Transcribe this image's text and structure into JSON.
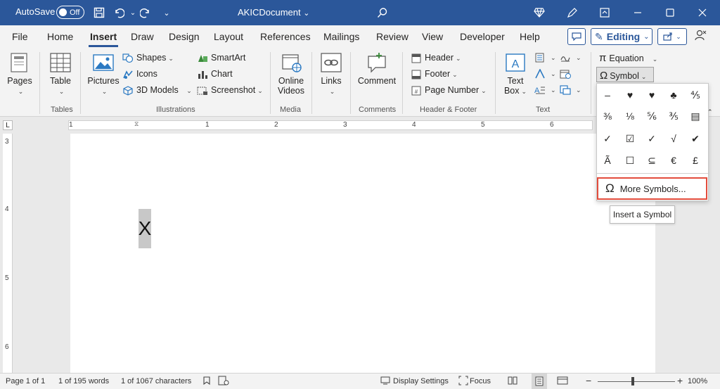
{
  "titlebar": {
    "autosave_label": "AutoSave",
    "autosave_state": "Off",
    "document_title": "AKICDocument"
  },
  "tabs": [
    "File",
    "Home",
    "Insert",
    "Draw",
    "Design",
    "Layout",
    "References",
    "Mailings",
    "Review",
    "View",
    "Developer",
    "Help"
  ],
  "active_tab": "Insert",
  "header_actions": {
    "editing_label": "Editing"
  },
  "ribbon": {
    "pages": {
      "label": "Pages"
    },
    "tables": {
      "table_label": "Table",
      "group": "Tables"
    },
    "illustrations": {
      "pictures": "Pictures",
      "shapes": "Shapes",
      "icons": "Icons",
      "models3d": "3D Models",
      "smartart": "SmartArt",
      "chart": "Chart",
      "screenshot": "Screenshot",
      "group": "Illustrations"
    },
    "media": {
      "online_videos_1": "Online",
      "online_videos_2": "Videos",
      "group": "Media"
    },
    "links": {
      "label": "Links"
    },
    "comments": {
      "comment": "Comment",
      "group": "Comments"
    },
    "header_footer": {
      "header": "Header",
      "footer": "Footer",
      "page_number": "Page Number",
      "group": "Header & Footer"
    },
    "text": {
      "text_box_1": "Text",
      "text_box_2": "Box",
      "group": "Text"
    },
    "symbols": {
      "equation": "Equation",
      "symbol": "Symbol"
    }
  },
  "ruler": {
    "h_numbers": [
      "1",
      "1",
      "2",
      "3",
      "4",
      "5",
      "6"
    ],
    "v_numbers": [
      "3",
      "4",
      "5",
      "6"
    ]
  },
  "document": {
    "text": "X"
  },
  "symbol_dropdown": {
    "symbols": [
      [
        "–",
        "♥",
        "♥",
        "♣",
        "⅘"
      ],
      [
        "⅜",
        "⅛",
        "⅚",
        "⅗",
        "▤"
      ],
      [
        "✓",
        "☑",
        "✓",
        "√",
        "✔"
      ],
      [
        "Ã",
        "☐",
        "⊆",
        "€",
        "£"
      ]
    ],
    "more_symbols": "More Symbols...",
    "tooltip": "Insert a Symbol"
  },
  "statusbar": {
    "page": "Page 1 of 1",
    "words": "1 of 195 words",
    "characters": "1 of 1067 characters",
    "display_settings": "Display Settings",
    "focus": "Focus",
    "zoom": "100%"
  },
  "colors": {
    "brand": "#2b579a",
    "highlight_border": "#e34c3c"
  }
}
